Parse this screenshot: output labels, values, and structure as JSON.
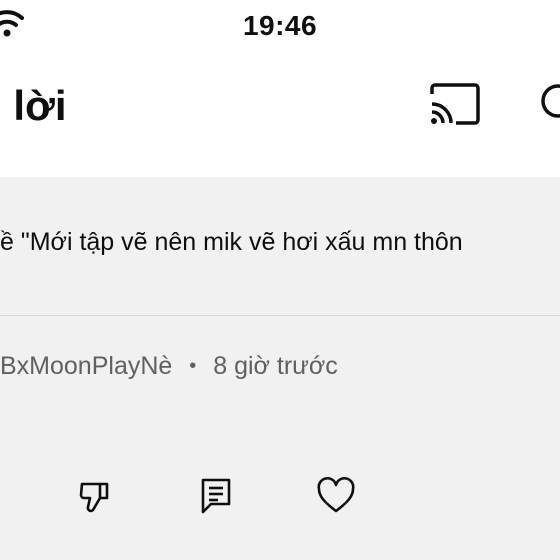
{
  "status_bar": {
    "time": "19:46"
  },
  "header": {
    "title": "i lời"
  },
  "comment": {
    "quote": "ề \"Mới tập vẽ nên mik vẽ hơi xấu mn thôn",
    "author": "BxMoonPlayNè",
    "separator": "•",
    "timestamp": "8 giờ trước"
  },
  "icons": {
    "wifi": "wifi-icon",
    "cast": "cast-icon",
    "search": "search-icon",
    "dislike": "dislike-icon",
    "reply": "reply-icon",
    "like": "heart-icon"
  }
}
